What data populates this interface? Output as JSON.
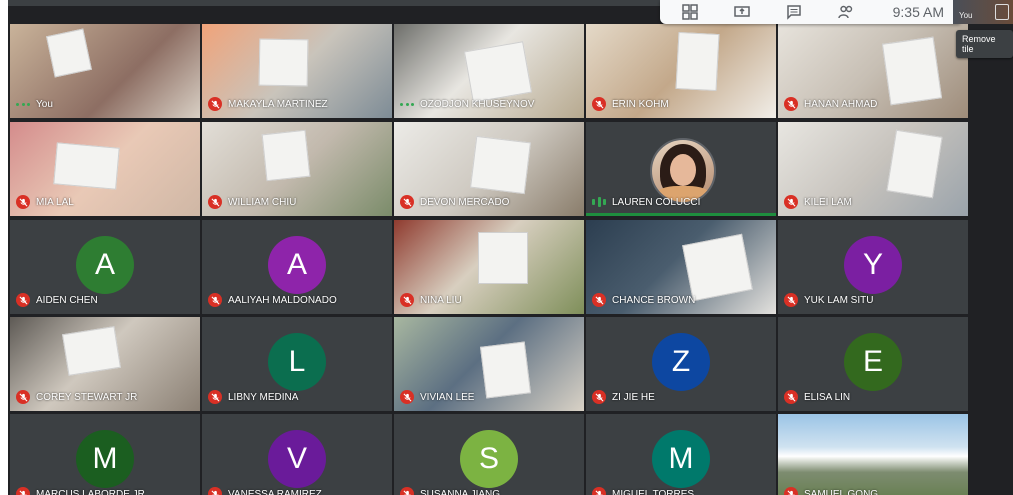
{
  "toolbar": {
    "icons": [
      "grid-layout-icon",
      "present-icon",
      "chat-icon",
      "people-icon"
    ],
    "clock": "9:35 AM"
  },
  "self_strip": {
    "text": "You"
  },
  "tooltip": {
    "text": "Remove tile"
  },
  "participants": [
    {
      "name": "You",
      "status": "active",
      "view": "video"
    },
    {
      "name": "MAKAYLA MARTINEZ",
      "status": "muted",
      "view": "video"
    },
    {
      "name": "OZODJON KHUSEYNOV",
      "status": "active",
      "view": "video"
    },
    {
      "name": "ERIN KOHM",
      "status": "muted",
      "view": "video"
    },
    {
      "name": "HANAN AHMAD",
      "status": "muted",
      "view": "video"
    },
    {
      "name": "MIA LAL",
      "status": "muted",
      "view": "video"
    },
    {
      "name": "WILLIAM CHIU",
      "status": "muted",
      "view": "video"
    },
    {
      "name": "DEVON MERCADO",
      "status": "muted",
      "view": "video"
    },
    {
      "name": "LAUREN COLUCCI",
      "status": "speaking",
      "view": "photo"
    },
    {
      "name": "KILEI LAM",
      "status": "muted",
      "view": "video"
    },
    {
      "name": "AIDEN CHEN",
      "status": "muted",
      "view": "avatar",
      "initial": "A",
      "color": "#2e7d32"
    },
    {
      "name": "AALIYAH MALDONADO",
      "status": "muted",
      "view": "avatar",
      "initial": "A",
      "color": "#8e24aa"
    },
    {
      "name": "NINA LIU",
      "status": "muted",
      "view": "video"
    },
    {
      "name": "CHANCE BROWN",
      "status": "muted",
      "view": "video"
    },
    {
      "name": "YUK LAM SITU",
      "status": "muted",
      "view": "avatar",
      "initial": "Y",
      "color": "#7b1fa2"
    },
    {
      "name": "COREY STEWART JR",
      "status": "muted",
      "view": "video"
    },
    {
      "name": "LIBNY MEDINA",
      "status": "muted",
      "view": "avatar",
      "initial": "L",
      "color": "#0b6e4f"
    },
    {
      "name": "VIVIAN LEE",
      "status": "muted",
      "view": "video"
    },
    {
      "name": "ZI JIE HE",
      "status": "muted",
      "view": "avatar",
      "initial": "Z",
      "color": "#0d47a1"
    },
    {
      "name": "ELISA LIN",
      "status": "muted",
      "view": "avatar",
      "initial": "E",
      "color": "#33691e"
    },
    {
      "name": "MARCUS LABORDE JR",
      "status": "muted",
      "view": "avatar",
      "initial": "M",
      "color": "#1b5e20"
    },
    {
      "name": "VANESSA RAMIREZ",
      "status": "muted",
      "view": "avatar",
      "initial": "V",
      "color": "#6a1b9a"
    },
    {
      "name": "SUSANNA JIANG",
      "status": "muted",
      "view": "avatar",
      "initial": "S",
      "color": "#7cb342"
    },
    {
      "name": "MIGUEL TORRES",
      "status": "muted",
      "view": "avatar",
      "initial": "M",
      "color": "#00796b"
    },
    {
      "name": "SAMUEL GONG",
      "status": "muted",
      "view": "video"
    }
  ]
}
